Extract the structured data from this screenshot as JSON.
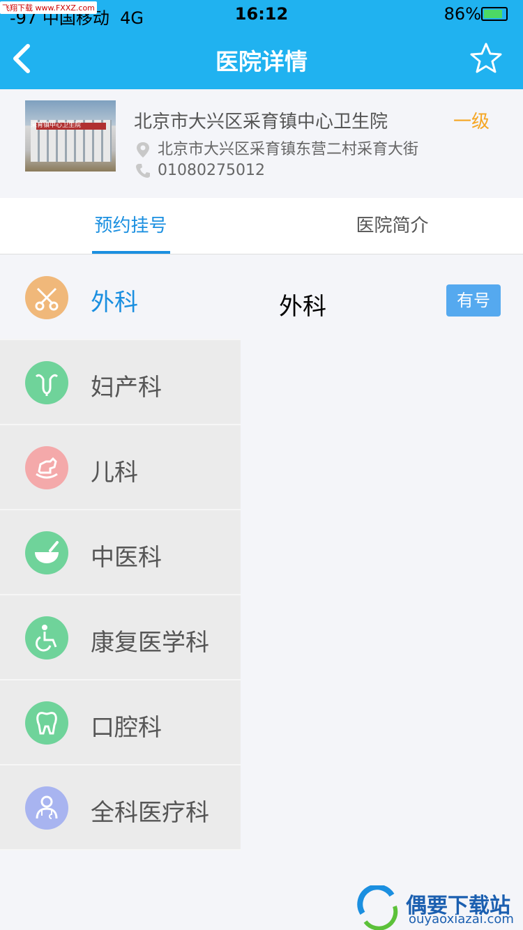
{
  "status_bar": {
    "carrier": "-97 中国移动",
    "network": "4G",
    "time": "16:12",
    "battery_percent": "86%",
    "battery_level": 0.86,
    "watermark": "飞翔下载 www.FXXZ.com"
  },
  "nav": {
    "title": "医院详情",
    "back_icon": "chevron-left-icon",
    "favorite_icon": "star-outline-icon"
  },
  "hospital": {
    "name": "北京市大兴区采育镇中心卫生院",
    "level": "一级",
    "address": "北京市大兴区采育镇东营二村采育大街",
    "phone": "01080275012",
    "photo_sign": "采育镇中心卫生院"
  },
  "tabs": [
    {
      "label": "预约挂号",
      "active": true
    },
    {
      "label": "医院简介",
      "active": false
    }
  ],
  "departments": [
    {
      "label": "外科",
      "icon": "scissors-icon",
      "color": "#f0b87a",
      "active": true
    },
    {
      "label": "妇产科",
      "icon": "uterus-icon",
      "color": "#6fd39a",
      "active": false
    },
    {
      "label": "儿科",
      "icon": "rocking-horse-icon",
      "color": "#f4a9aa",
      "active": false
    },
    {
      "label": "中医科",
      "icon": "mortar-bowl-icon",
      "color": "#6fd39a",
      "active": false
    },
    {
      "label": "康复医学科",
      "icon": "wheelchair-icon",
      "color": "#6fd39a",
      "active": false
    },
    {
      "label": "口腔科",
      "icon": "tooth-icon",
      "color": "#6fd39a",
      "active": false
    },
    {
      "label": "全科医疗科",
      "icon": "doctor-icon",
      "color": "#a8b4f0",
      "active": false
    }
  ],
  "detail": {
    "title": "外科",
    "availability_label": "有号"
  },
  "watermark_logo": {
    "text": "偶要下载站",
    "sub": "ouyaoxiazai.com"
  },
  "colors": {
    "brand": "#20b2f0",
    "accent_blue": "#1a8fe0",
    "level_orange": "#f5a623"
  }
}
